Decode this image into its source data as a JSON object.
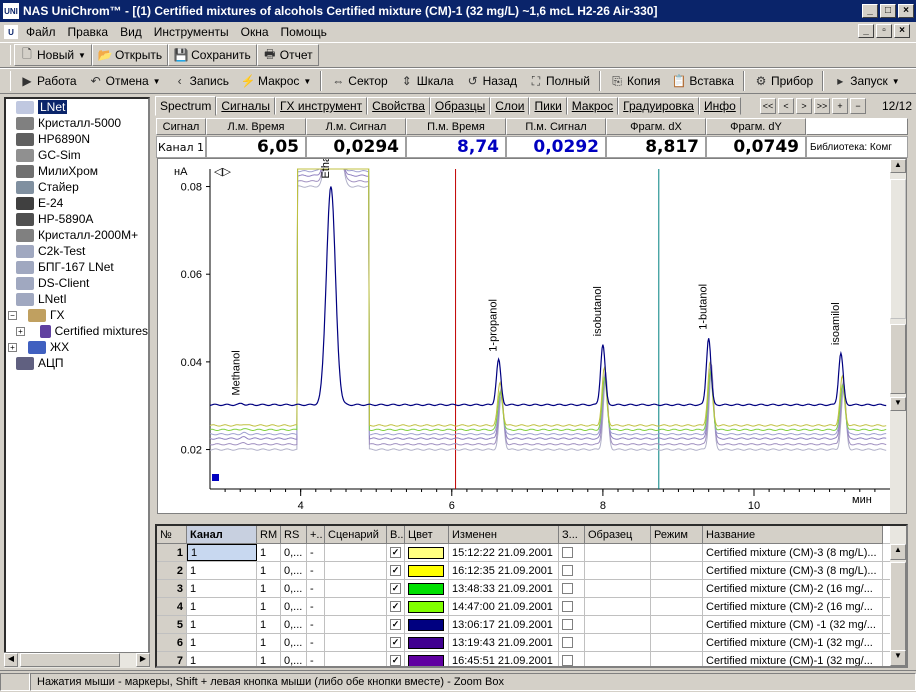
{
  "window": {
    "title": "NAS UniChrom™ - [(1) Certified mixtures of alcohols Certified mixture (CM)-1 (32 mg/L)  ~1,6 mcL  H2-26 Air-330]",
    "icon_text": "UNI"
  },
  "menu": [
    "Файл",
    "Правка",
    "Вид",
    "Инструменты",
    "Окна",
    "Помощь"
  ],
  "toolbar1": [
    {
      "label": "Новый",
      "icon": "new-doc-icon",
      "glyph": "🗋",
      "dropdown": true
    },
    {
      "label": "Открыть",
      "icon": "open-folder-icon",
      "glyph": "📂"
    },
    {
      "label": "Сохранить",
      "icon": "save-icon",
      "glyph": "💾"
    },
    {
      "label": "Отчет",
      "icon": "print-icon",
      "glyph": "🖶"
    }
  ],
  "toolbar2": [
    {
      "label": "Работа",
      "icon": "play-icon",
      "glyph": "▶"
    },
    {
      "label": "Отмена",
      "icon": "undo-icon",
      "glyph": "↶",
      "dropdown": true
    },
    {
      "label": "Запись",
      "icon": "record-icon",
      "glyph": "‹"
    },
    {
      "label": "Макрос",
      "icon": "macro-icon",
      "glyph": "⚡",
      "dropdown": true
    },
    {
      "label": "Сектор",
      "icon": "sector-icon",
      "glyph": "⇔"
    },
    {
      "label": "Шкала",
      "icon": "scale-icon",
      "glyph": "⇕"
    },
    {
      "label": "Назад",
      "icon": "back-icon",
      "glyph": "↺"
    },
    {
      "label": "Полный",
      "icon": "full-icon",
      "glyph": "⛶"
    },
    {
      "label": "Копия",
      "icon": "copy-icon",
      "glyph": "⎘"
    },
    {
      "label": "Вставка",
      "icon": "paste-icon",
      "glyph": "📋"
    },
    {
      "label": "Прибор",
      "icon": "device-icon",
      "glyph": "⚙"
    },
    {
      "label": "Запуск",
      "icon": "start-icon",
      "glyph": "▸",
      "dropdown": true
    }
  ],
  "tree": [
    {
      "label": "LNet",
      "color": "#c0c8e0",
      "indent": 0,
      "selected": true
    },
    {
      "label": "Кристалл-5000",
      "color": "#808080",
      "indent": 0
    },
    {
      "label": "HP6890N",
      "color": "#606060",
      "indent": 0
    },
    {
      "label": "GC-Sim",
      "color": "#909090",
      "indent": 0
    },
    {
      "label": "МилиХром",
      "color": "#707070",
      "indent": 0
    },
    {
      "label": "Стайер",
      "color": "#8090a0",
      "indent": 0
    },
    {
      "label": "E-24",
      "color": "#404040",
      "indent": 0
    },
    {
      "label": "HP-5890A",
      "color": "#505050",
      "indent": 0
    },
    {
      "label": "Кристалл-2000М+",
      "color": "#808080",
      "indent": 0
    },
    {
      "label": "C2k-Test",
      "color": "#a0a8c0",
      "indent": 0
    },
    {
      "label": "БПГ-167 LNet",
      "color": "#a0a8c0",
      "indent": 0
    },
    {
      "label": "DS-Client",
      "color": "#a0a8c0",
      "indent": 0
    },
    {
      "label": "LNetI",
      "color": "#a0a8c0",
      "indent": 0
    },
    {
      "label": "ГХ",
      "color": "#c0a060",
      "indent": 0,
      "expander": "−"
    },
    {
      "label": "Certified mixtures",
      "color": "#6040a0",
      "indent": 1,
      "expander": "+"
    },
    {
      "label": "ЖХ",
      "color": "#4060c0",
      "indent": 0,
      "expander": "+"
    },
    {
      "label": "АЦП",
      "color": "#606080",
      "indent": 0
    }
  ],
  "tabs": [
    {
      "label": "Spectrum",
      "active": true
    },
    {
      "label": "Сигналы"
    },
    {
      "label": "ГХ инструмент"
    },
    {
      "label": "Свойства"
    },
    {
      "label": "Образцы"
    },
    {
      "label": "Слои"
    },
    {
      "label": "Пики"
    },
    {
      "label": "Макрос"
    },
    {
      "label": "Градуировка"
    },
    {
      "label": "Инфо"
    }
  ],
  "nav": {
    "buttons": [
      "<<",
      "<",
      ">",
      ">>",
      "+",
      "−"
    ],
    "page": "12/12"
  },
  "markers": {
    "headers": [
      "Сигнал",
      "Л.м. Время",
      "Л.м. Сигнал",
      "П.м. Время",
      "П.м. Сигнал",
      "Фрагм. dX",
      "Фрагм. dY"
    ],
    "row_label": "Канал 1",
    "values": [
      "6,05",
      "0,0294",
      "8,74",
      "0,0292",
      "8,817",
      "0,0749"
    ],
    "value_colors": [
      "#000",
      "#000",
      "#0000c0",
      "#0000c0",
      "#000",
      "#000"
    ],
    "library": "Библиотека: Комг"
  },
  "chart_data": {
    "type": "line",
    "ylabel": "нА",
    "xlabel": "мин",
    "x_range": [
      2.8,
      11.8
    ],
    "y_range": [
      0.011,
      0.084
    ],
    "x_ticks": [
      4,
      6,
      8,
      10
    ],
    "y_ticks": [
      0.02,
      0.04,
      0.06,
      0.08
    ],
    "y_tick_labels": [
      "0.02",
      "0.04",
      "0.06",
      "0.08"
    ],
    "x_tick_labels": [
      "4",
      "6",
      "8",
      "10"
    ],
    "left_marker_min": 6.05,
    "right_marker_min": 8.74,
    "peaks": [
      {
        "name": "Methanol",
        "x": 3.22,
        "y": 0.0305
      },
      {
        "name": "Ethanol",
        "x": 4.4,
        "y": 0.08
      },
      {
        "name": "1-propanol",
        "x": 6.62,
        "y": 0.0405
      },
      {
        "name": "isobutanol",
        "x": 8.0,
        "y": 0.044
      },
      {
        "name": "1-butanol",
        "x": 9.4,
        "y": 0.0455
      },
      {
        "name": "isoamilol",
        "x": 11.15,
        "y": 0.042
      }
    ],
    "series": [
      {
        "color": "#000080",
        "baseline": 0.0302,
        "scale": 1.0
      },
      {
        "color": "#c0c040",
        "baseline": 0.0255,
        "scale": 1.05
      },
      {
        "color": "#80d040",
        "baseline": 0.0245,
        "scale": 0.95
      },
      {
        "color": "#a0a0d0",
        "baseline": 0.0235,
        "scale": 1.1
      },
      {
        "color": "#9080c0",
        "baseline": 0.0225,
        "scale": 1.2
      },
      {
        "color": "#a090c0",
        "baseline": 0.0212,
        "scale": 1.35
      },
      {
        "color": "#b0b0c8",
        "baseline": 0.02,
        "scale": 1.3
      }
    ]
  },
  "grid": {
    "headers": [
      "№",
      "Канал",
      "RM",
      "RS",
      "+..",
      "Сценарий",
      "В..",
      "Цвет",
      "Изменен",
      "З...",
      "Образец",
      "Режим",
      "Название"
    ],
    "rows": [
      {
        "n": "1",
        "ch": "1",
        "rm": "1",
        "rs": "0,...",
        "p": "-",
        "v": true,
        "color": "#ffff80",
        "time": "15:12:22 21.09.2001",
        "name": "Certified mixture (CM)-3  (8 mg/L)...",
        "selected": true
      },
      {
        "n": "2",
        "ch": "1",
        "rm": "1",
        "rs": "0,...",
        "p": "-",
        "v": true,
        "color": "#ffff00",
        "time": "16:12:35 21.09.2001",
        "name": "Certified mixture (CM)-3  (8 mg/L)..."
      },
      {
        "n": "3",
        "ch": "1",
        "rm": "1",
        "rs": "0,...",
        "p": "-",
        "v": true,
        "color": "#00e000",
        "time": "13:48:33 21.09.2001",
        "name": "Certified mixture (CM)-2  (16 mg/..."
      },
      {
        "n": "4",
        "ch": "1",
        "rm": "1",
        "rs": "0,...",
        "p": "-",
        "v": true,
        "color": "#80ff00",
        "time": "14:47:00 21.09.2001",
        "name": "Certified mixture (CM)-2  (16 mg/..."
      },
      {
        "n": "5",
        "ch": "1",
        "rm": "1",
        "rs": "0,...",
        "p": "-",
        "v": true,
        "color": "#000080",
        "time": "13:06:17 21.09.2001",
        "name": "Certified mixture (CM) -1  (32 mg/..."
      },
      {
        "n": "6",
        "ch": "1",
        "rm": "1",
        "rs": "0,...",
        "p": "-",
        "v": true,
        "color": "#400090",
        "time": "13:19:43 21.09.2001",
        "name": "Certified mixture (CM)-1  (32 mg/..."
      },
      {
        "n": "7",
        "ch": "1",
        "rm": "1",
        "rs": "0,...",
        "p": "-",
        "v": true,
        "color": "#6000a0",
        "time": "16:45:51 21.09.2001",
        "name": "Certified mixture (CM)-1  (32 mg/..."
      }
    ]
  },
  "status": "Нажатия мыши - маркеры, Shift + левая кнопка мыши  (либо обе кнопки вместе) - Zoom Box"
}
